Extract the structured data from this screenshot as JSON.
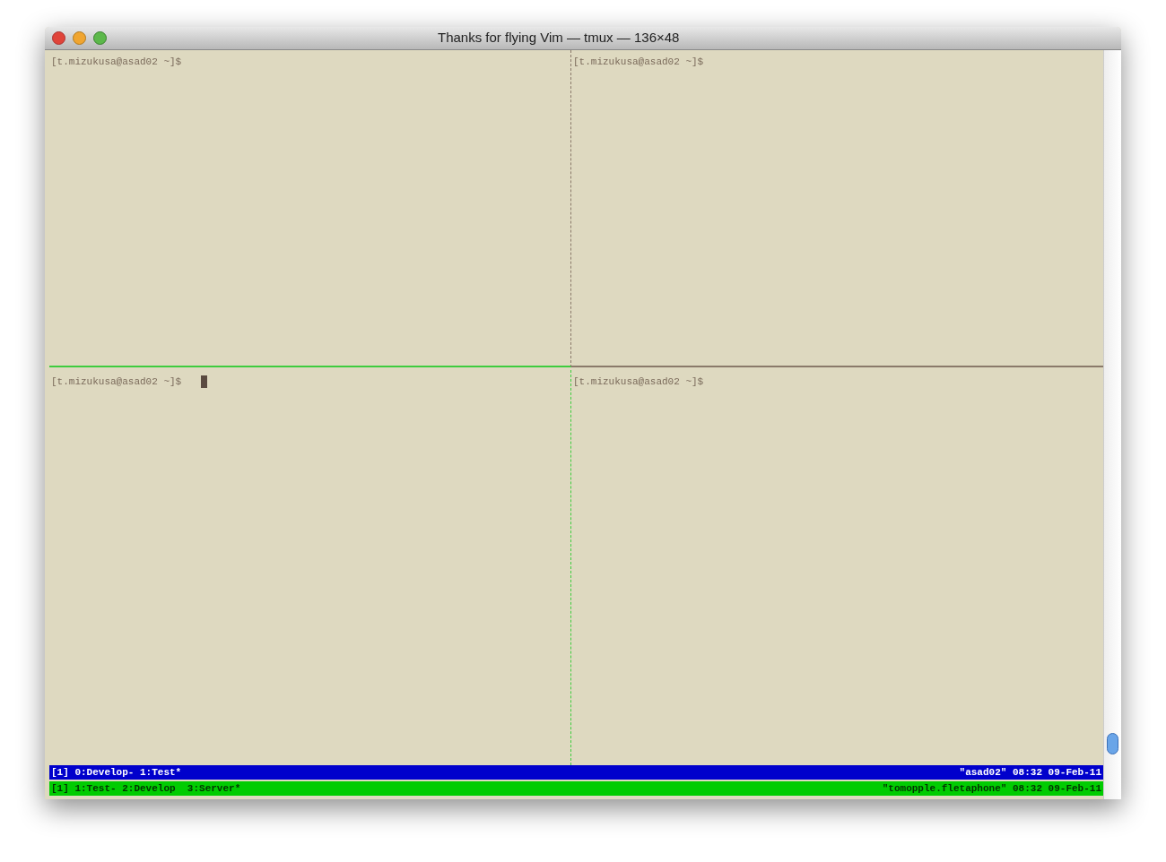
{
  "window": {
    "title": "Thanks for flying Vim — tmux — 136×48"
  },
  "panes": [
    {
      "prompt": "[t.mizukusa@asad02 ~]$",
      "active": false
    },
    {
      "prompt": "[t.mizukusa@asad02 ~]$",
      "active": false
    },
    {
      "prompt": "[t.mizukusa@asad02 ~]$",
      "active": true
    },
    {
      "prompt": "[t.mizukusa@asad02 ~]$",
      "active": false
    }
  ],
  "status_lines": [
    {
      "color": "#0000cc",
      "left": "[1] 0:Develop- 1:Test*",
      "right": "\"asad02\" 08:32 09-Feb-11"
    },
    {
      "color": "#00cc00",
      "left": "[1] 1:Test- 2:Develop  3:Server*",
      "right": "\"tomopple.fletaphone\" 08:32 09-Feb-11"
    }
  ]
}
